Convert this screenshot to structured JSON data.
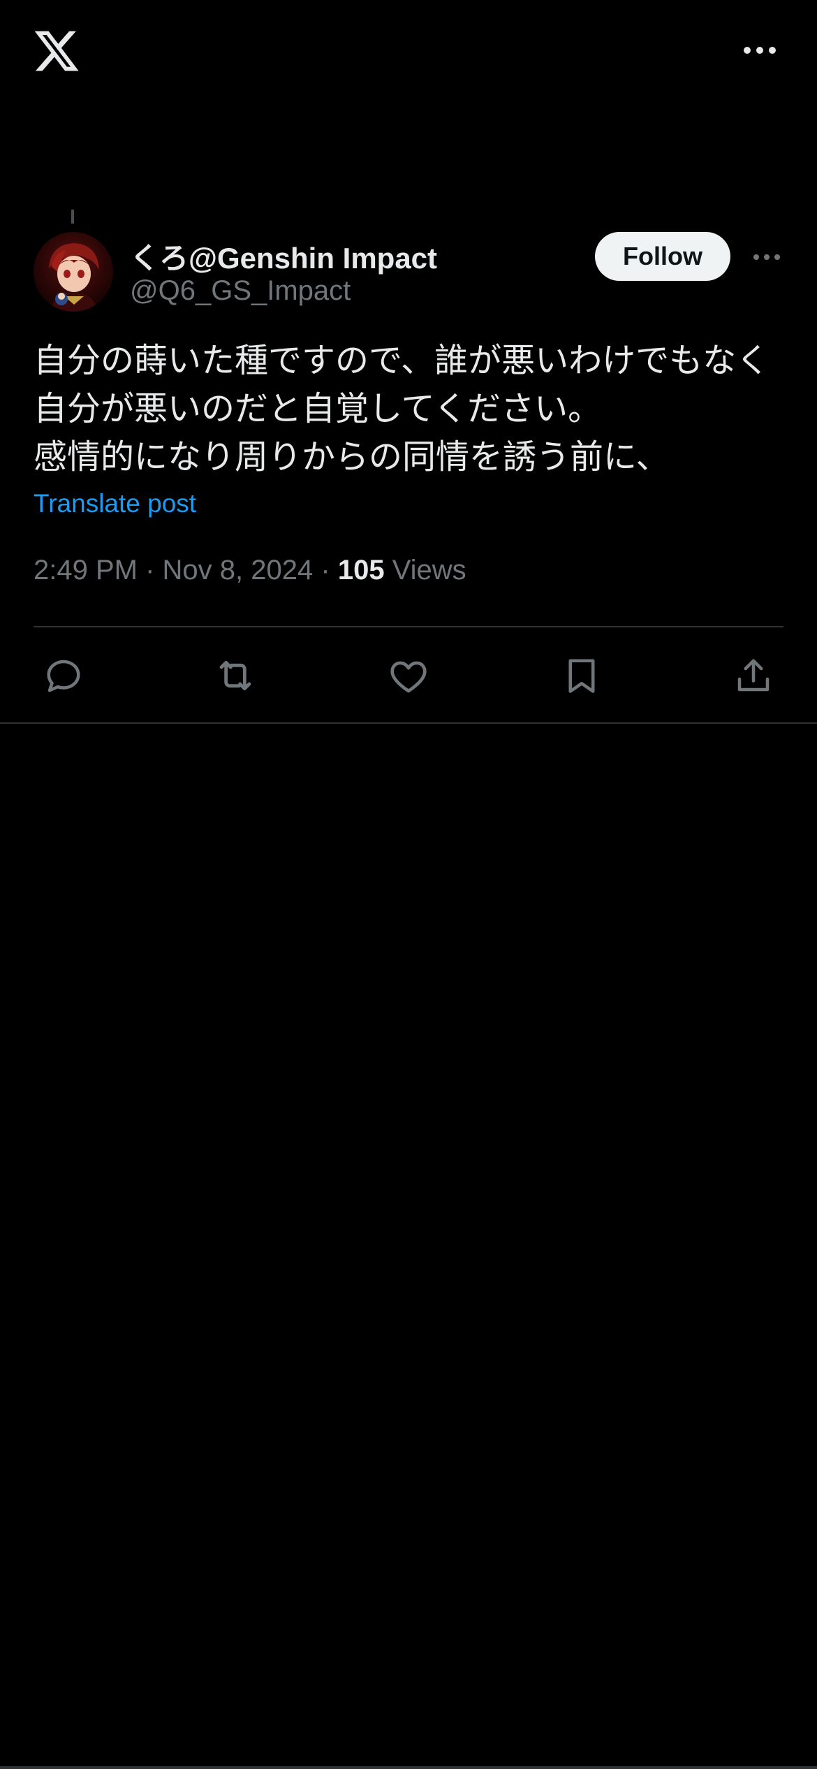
{
  "app": {
    "logo_icon": "x-logo-icon",
    "more_icon": "more-horizontal-icon"
  },
  "post": {
    "author": {
      "display_name": "くろ@Genshin Impact",
      "handle": "@Q6_GS_Impact",
      "avatar_icon": "avatar-image"
    },
    "follow_label": "Follow",
    "text_lines": [
      "自分の蒔いた種ですので、誰が悪いわけでもなく",
      "自分が悪いのだと自覚してください。",
      "感情的になり周りからの同情を誘う前に、"
    ],
    "translate_label": "Translate post",
    "time": "2:49 PM",
    "separator": "·",
    "date": "Nov 8, 2024",
    "views_count": "105",
    "views_label": "Views"
  },
  "actions": [
    {
      "icon": "reply-icon"
    },
    {
      "icon": "repost-icon"
    },
    {
      "icon": "like-icon"
    },
    {
      "icon": "bookmark-icon"
    },
    {
      "icon": "share-icon"
    }
  ],
  "colors": {
    "background": "#000000",
    "text": "#e7e9ea",
    "secondary": "#71767b",
    "link": "#1d9bf0",
    "divider": "#2f3336",
    "button_bg": "#eff3f4"
  }
}
